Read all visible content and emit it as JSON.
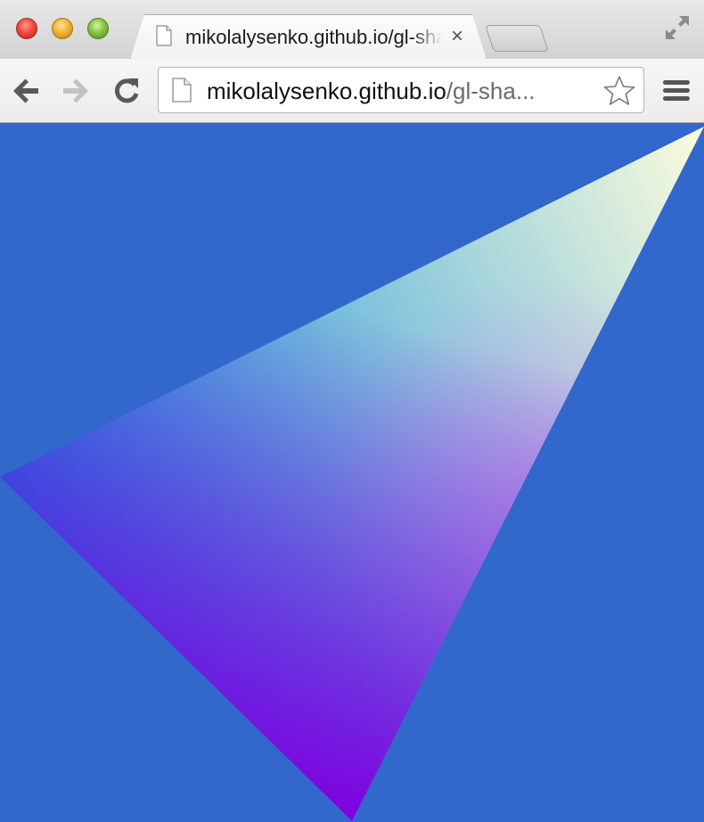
{
  "window": {
    "controls": {
      "close_icon": "close-traffic-light",
      "minimize_icon": "minimize-traffic-light",
      "zoom_icon": "zoom-traffic-light",
      "fullscreen_icon": "fullscreen-arrows-icon"
    }
  },
  "tabs": [
    {
      "title": "mikolalysenko.github.io/gl-shader",
      "icon": "page-icon",
      "close_glyph": "×",
      "active": true
    }
  ],
  "toolbar": {
    "back_icon": "back-arrow-icon",
    "forward_icon": "forward-arrow-icon",
    "reload_icon": "reload-icon",
    "url": {
      "host": "mikolalysenko.github.io",
      "path": "/gl-sha..."
    },
    "bookmark_icon": "star-icon",
    "menu_icon": "hamburger-menu-icon"
  },
  "canvas": {
    "background_color": "#3267cc",
    "triangle_colors": {
      "left_vertex": "#0088dd",
      "top_right_vertex": "#fcfcdc",
      "bottom_vertex": "#8000e0"
    }
  }
}
